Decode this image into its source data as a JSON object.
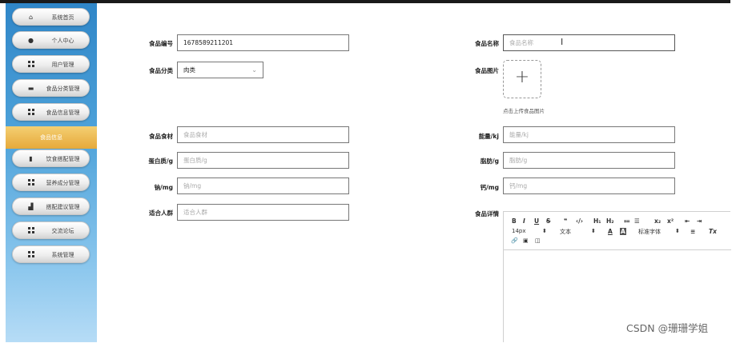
{
  "sidebar": {
    "items": [
      {
        "label": "系统首页",
        "icon": "home-icon"
      },
      {
        "label": "个人中心",
        "icon": "user-icon"
      },
      {
        "label": "用户管理",
        "icon": "grid-icon"
      },
      {
        "label": "食品分类管理",
        "icon": "briefcase-icon"
      },
      {
        "label": "食品信息管理",
        "icon": "grid-icon"
      },
      {
        "label": "饮食搭配管理",
        "icon": "clipboard-icon"
      },
      {
        "label": "营养成分管理",
        "icon": "grid-icon"
      },
      {
        "label": "搭配建议管理",
        "icon": "bar-chart-icon"
      },
      {
        "label": "交流论坛",
        "icon": "grid-icon"
      },
      {
        "label": "系统管理",
        "icon": "grid-icon"
      }
    ],
    "active": "食品信息"
  },
  "form": {
    "food_no": {
      "label": "食品编号",
      "value": "1678589211201"
    },
    "food_name": {
      "label": "食品名称",
      "placeholder": "食品名称"
    },
    "category": {
      "label": "食品分类",
      "value": "肉类"
    },
    "image": {
      "label": "食品图片",
      "hint": "点击上传食品图片",
      "plus": "+"
    },
    "ingredients": {
      "label": "食品食材",
      "placeholder": "食品食材"
    },
    "energy": {
      "label": "能量/kj",
      "placeholder": "能量/kj"
    },
    "protein": {
      "label": "蛋白质/g",
      "placeholder": "蛋白质/g"
    },
    "fat": {
      "label": "脂肪/g",
      "placeholder": "脂肪/g"
    },
    "sodium": {
      "label": "钠/mg",
      "placeholder": "钠/mg"
    },
    "calcium": {
      "label": "钙/mg",
      "placeholder": "钙/mg"
    },
    "audience": {
      "label": "适合人群",
      "placeholder": "适合人群"
    },
    "details": {
      "label": "食品详情"
    }
  },
  "editor": {
    "bold": "B",
    "italic": "I",
    "underline": "U",
    "strike": "S",
    "quote": "❞",
    "code": "‹/›",
    "h1": "H₁",
    "h2": "H₂",
    "ol": "≔",
    "ul": "☰",
    "sub": "x₂",
    "sup": "x²",
    "outdent": "⇤",
    "indent": "⇥",
    "font_size": "14px",
    "text_style": "文本",
    "font_family": "标准字体",
    "dropdown_arrow": "⬍",
    "color_a": "A",
    "bg_a": "A",
    "align": "≡",
    "clear": "Tx",
    "link": "🔗",
    "image": "▣",
    "video": "◫"
  },
  "cursor": "I",
  "watermark": "CSDN @珊珊学姐"
}
